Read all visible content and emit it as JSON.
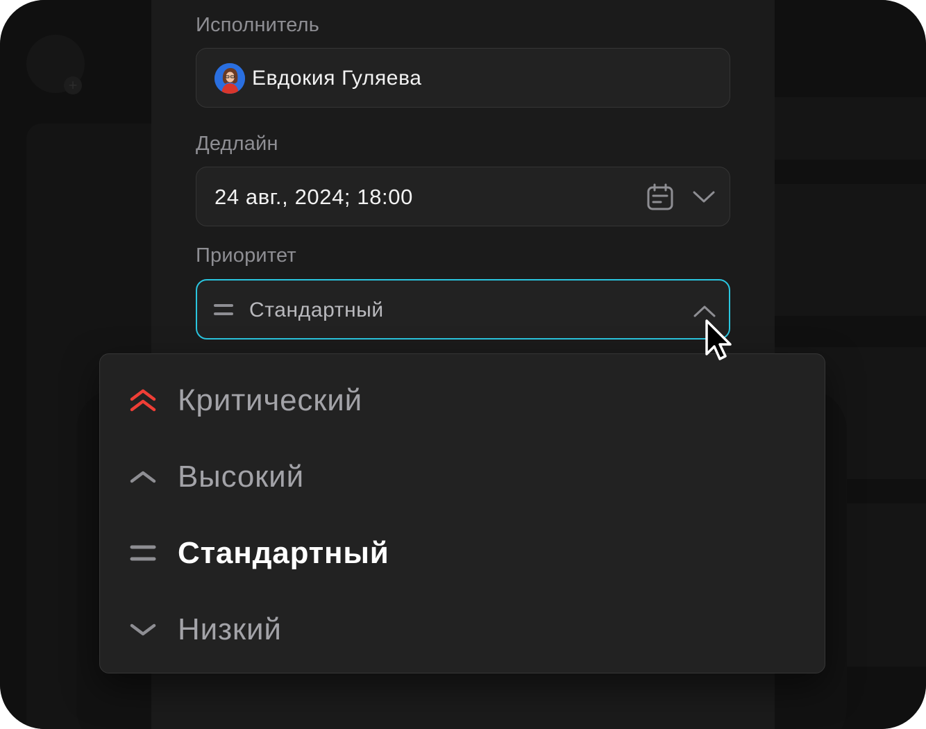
{
  "form": {
    "assignee": {
      "label": "Исполнитель",
      "value": "Евдокия Гуляева",
      "avatar_icon": "user-avatar"
    },
    "deadline": {
      "label": "Дедлайн",
      "value": "24 авг., 2024; 18:00",
      "icons": [
        "calendar-icon",
        "chevron-down-icon"
      ]
    },
    "priority": {
      "label": "Приоритет",
      "value": "Стандартный",
      "icon": "equals-icon",
      "open": true,
      "icon_toggle": "chevron-up-icon"
    }
  },
  "priority_menu": {
    "items": [
      {
        "label": "Критический",
        "icon": "double-chevron-up-icon",
        "color": "#ef3e36",
        "selected": false
      },
      {
        "label": "Высокий",
        "icon": "chevron-up-icon",
        "color": "#8e8e93",
        "selected": false
      },
      {
        "label": "Стандартный",
        "icon": "equals-icon",
        "color": "#8e8e93",
        "selected": true
      },
      {
        "label": "Низкий",
        "icon": "chevron-down-icon",
        "color": "#8e8e93",
        "selected": false
      }
    ]
  },
  "colors": {
    "accent": "#2ac6e0",
    "critical": "#ef3e36",
    "background": "#111111",
    "panel": "#1b1b1b"
  }
}
